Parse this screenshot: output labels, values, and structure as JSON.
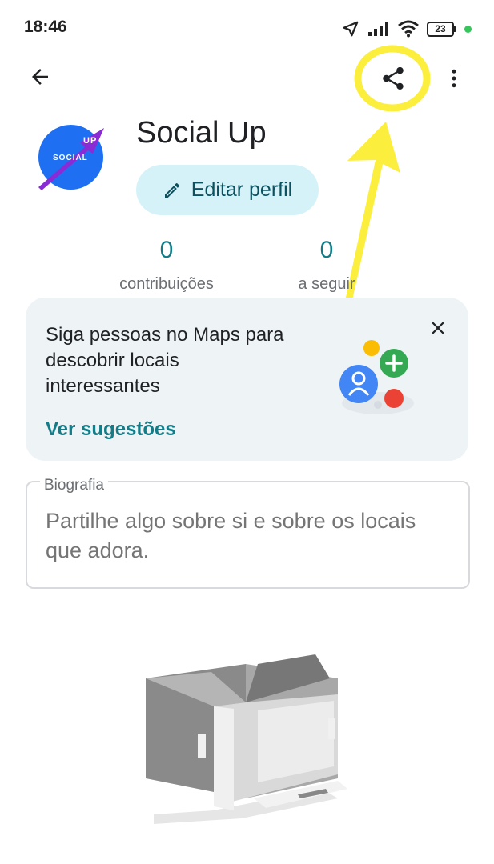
{
  "status_bar": {
    "time": "18:46",
    "battery": "23",
    "icons": [
      "location-arrow-icon",
      "signal-icon",
      "wifi-icon",
      "battery-icon"
    ]
  },
  "app_bar": {
    "icons": [
      "back-arrow-icon",
      "share-icon",
      "more-vert-icon"
    ]
  },
  "profile": {
    "avatar_text_top": "UP",
    "avatar_text_bottom": "SOCIAL",
    "name": "Social Up",
    "edit_button": "Editar perfil"
  },
  "stats": [
    {
      "value": "0",
      "label": "contribuições"
    },
    {
      "value": "0",
      "label": "a seguir"
    }
  ],
  "suggestion_card": {
    "text": "Siga pessoas no Maps para descobrir locais interessantes",
    "link": "Ver sugestões"
  },
  "biography": {
    "label": "Biografia",
    "placeholder": "Partilhe algo sobre si e sobre os locais que adora."
  },
  "colors": {
    "accent": "#137c87",
    "edit_button_bg": "#d6f2f9",
    "card_bg": "#eef3f6",
    "highlight_yellow": "#fbee3c"
  }
}
